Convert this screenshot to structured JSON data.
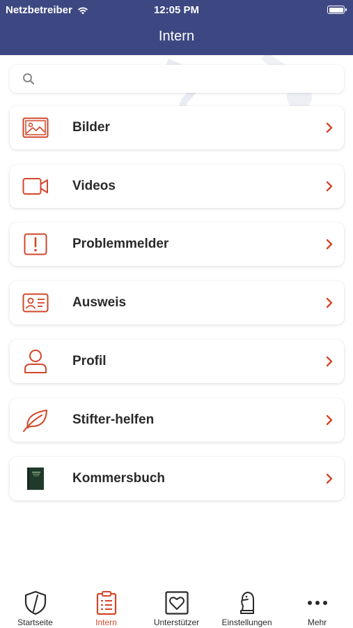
{
  "status_bar": {
    "carrier": "Netzbetreiber",
    "time": "12:05 PM"
  },
  "header": {
    "title": "Intern"
  },
  "search": {
    "value": "",
    "placeholder": ""
  },
  "menu": {
    "items": [
      {
        "label": "Bilder",
        "icon": "image-icon"
      },
      {
        "label": "Videos",
        "icon": "video-camera-icon"
      },
      {
        "label": "Problemmelder",
        "icon": "exclamation-icon"
      },
      {
        "label": "Ausweis",
        "icon": "id-card-icon"
      },
      {
        "label": "Profil",
        "icon": "user-icon"
      },
      {
        "label": "Stifter-helfen",
        "icon": "leaf-icon"
      },
      {
        "label": "Kommersbuch",
        "icon": "book-cover-icon"
      }
    ]
  },
  "tabbar": {
    "tabs": [
      {
        "label": "Startseite",
        "icon": "shield-icon",
        "active": false
      },
      {
        "label": "Intern",
        "icon": "clipboard-list-icon",
        "active": true
      },
      {
        "label": "Unterstützer",
        "icon": "heart-icon",
        "active": false
      },
      {
        "label": "Einstellungen",
        "icon": "chess-knight-icon",
        "active": false
      },
      {
        "label": "Mehr",
        "icon": "more-dots-icon",
        "active": false
      }
    ]
  },
  "colors": {
    "header_bg": "#3d4882",
    "accent": "#d2462a",
    "text": "#2a2a2a"
  }
}
